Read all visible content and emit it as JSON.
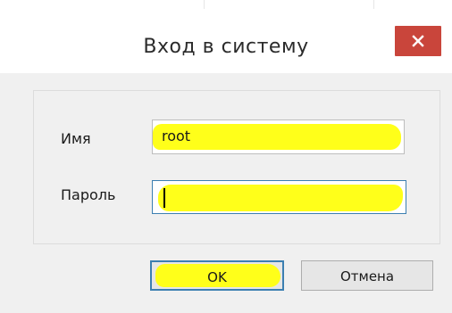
{
  "dialog": {
    "title": "Вход в систему",
    "close_icon": "close-icon",
    "close_color": "#c9453b"
  },
  "form": {
    "username_label": "Имя",
    "username_value": "root",
    "password_label": "Пароль",
    "password_value": ""
  },
  "buttons": {
    "ok_label": "OK",
    "cancel_label": "Отмена"
  },
  "highlight_color": "#ffff1a"
}
